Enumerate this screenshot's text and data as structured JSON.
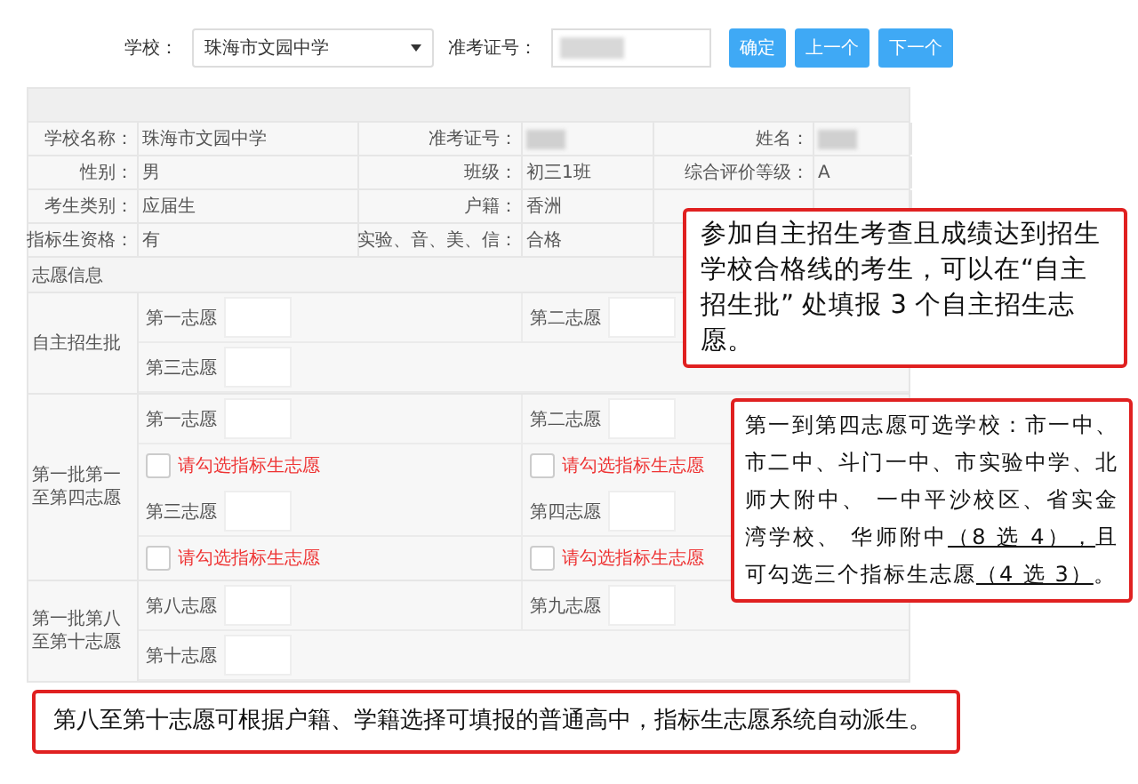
{
  "filter": {
    "school_label": "学校：",
    "school_value": "珠海市文园中学",
    "exam_no_label": "准考证号：",
    "exam_no_redacted": true,
    "buttons": [
      "确定",
      "上一个",
      "下一个"
    ]
  },
  "info": {
    "rows": [
      [
        {
          "label": "学校名称：",
          "value": "珠海市文园中学"
        },
        {
          "label": "准考证号：",
          "redacted": true
        },
        {
          "label": "姓名：",
          "redacted": true
        }
      ],
      [
        {
          "label": "性别：",
          "value": "男"
        },
        {
          "label": "班级：",
          "value": "初三1班"
        },
        {
          "label": "综合评价等级：",
          "value": "A"
        }
      ],
      [
        {
          "label": "考生类别：",
          "value": "应届生"
        },
        {
          "label": "户籍：",
          "value": "香洲"
        }
      ],
      [
        {
          "label": "指标生资格：",
          "value": "有"
        },
        {
          "label": "实验、音、美、信：",
          "value": "合格"
        }
      ]
    ]
  },
  "choices": {
    "title": "志愿信息",
    "groups": [
      {
        "name": "自主招生批",
        "rows": [
          {
            "kind": "inputs",
            "items": [
              "第一志愿",
              "第二志愿"
            ]
          },
          {
            "kind": "inputs",
            "items": [
              "第三志愿"
            ]
          }
        ]
      },
      {
        "name": "第一批第一至第四志愿",
        "rows": [
          {
            "kind": "inputs",
            "items": [
              "第一志愿",
              "第二志愿"
            ]
          },
          {
            "kind": "checkboxes",
            "items": [
              {
                "label": "请勾选指标生志愿",
                "checked": false
              },
              {
                "label": "请勾选指标生志愿",
                "checked": false
              }
            ]
          },
          {
            "kind": "inputs",
            "items": [
              "第三志愿",
              "第四志愿"
            ]
          },
          {
            "kind": "checkboxes",
            "items": [
              {
                "label": "请勾选指标生志愿",
                "checked": false
              },
              {
                "label": "请勾选指标生志愿",
                "checked": false
              }
            ]
          }
        ]
      },
      {
        "name": "第一批第八至第十志愿",
        "rows": [
          {
            "kind": "inputs",
            "items": [
              "第八志愿",
              "第九志愿"
            ]
          },
          {
            "kind": "inputs",
            "items": [
              "第十志愿"
            ]
          }
        ]
      }
    ]
  },
  "callouts": [
    {
      "kind": "top-right",
      "segments": [
        {
          "text": "参加自主招生考查且成绩达到招生学校合格线的考生，可以在“自主招生批” 处填报 3 个自主招生志愿。",
          "underline": false
        }
      ]
    },
    {
      "kind": "middle-right",
      "segments": [
        {
          "text": "第一到第四志愿可选学校：市一中、市二中、斗门一中、市实验中学、北师大附中、 一中平沙校区、省实金湾学校、 华师附中",
          "underline": false
        },
        {
          "text": "（8 选 4），",
          "underline": true
        },
        {
          "text": "且可勾选三个指标生志愿",
          "underline": false
        },
        {
          "text": "（4 选 3）",
          "underline": true
        },
        {
          "text": "。",
          "underline": false
        }
      ]
    },
    {
      "kind": "bottom",
      "segments": [
        {
          "text": "第八至第十志愿可根据户籍、学籍选择可填报的普通高中，指标生志愿系统自动派生。",
          "underline": false
        }
      ]
    }
  ]
}
